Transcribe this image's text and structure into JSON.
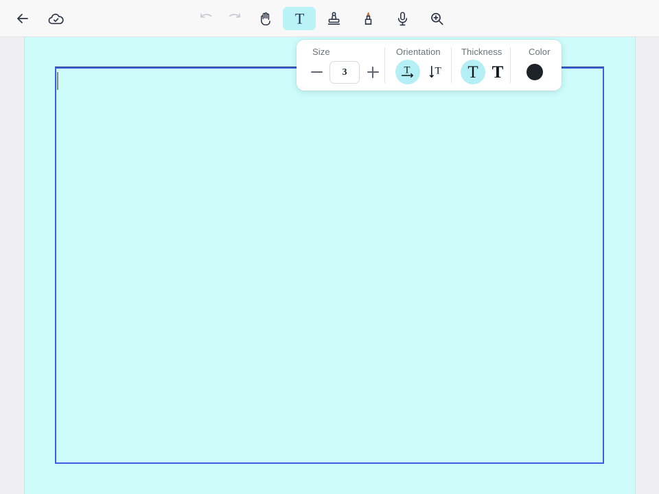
{
  "toolbar": {
    "left_buttons": [
      {
        "name": "back-arrow-icon",
        "label": "Back"
      },
      {
        "name": "cloud-saved-icon",
        "label": "Saved to cloud"
      }
    ],
    "tools": [
      {
        "name": "undo-icon",
        "label": "Undo",
        "state": "disabled"
      },
      {
        "name": "redo-icon",
        "label": "Redo",
        "state": "disabled"
      },
      {
        "name": "hand-pan-icon",
        "label": "Pan",
        "state": "normal"
      },
      {
        "name": "text-tool-icon",
        "label": "Text",
        "state": "selected"
      },
      {
        "name": "stamp-icon",
        "label": "Stamp",
        "state": "normal"
      },
      {
        "name": "marker-pen-icon",
        "label": "Marker",
        "state": "normal"
      },
      {
        "name": "microphone-icon",
        "label": "Voice note",
        "state": "normal"
      },
      {
        "name": "zoom-in-icon",
        "label": "Zoom",
        "state": "normal"
      }
    ]
  },
  "options_panel": {
    "size": {
      "label": "Size",
      "decrease_label": "−",
      "value": "3",
      "placeholder": "3",
      "increase_label": "+"
    },
    "orientation": {
      "label": "Orientation",
      "options": [
        {
          "name": "horizontal-text-icon",
          "label": "Horizontal",
          "selected": true
        },
        {
          "name": "vertical-text-icon",
          "label": "Vertical",
          "selected": false
        }
      ]
    },
    "thickness": {
      "label": "Thickness",
      "options": [
        {
          "name": "thin-text-icon",
          "label": "Regular",
          "selected": true
        },
        {
          "name": "bold-text-icon",
          "label": "Bold",
          "selected": false
        }
      ]
    },
    "color": {
      "label": "Color",
      "value": "#1e2229"
    }
  },
  "canvas": {
    "background_color": "#cdfcfb",
    "text_box": {
      "border_color": "#3b5fe0",
      "content": "",
      "caret_visible": true
    }
  }
}
